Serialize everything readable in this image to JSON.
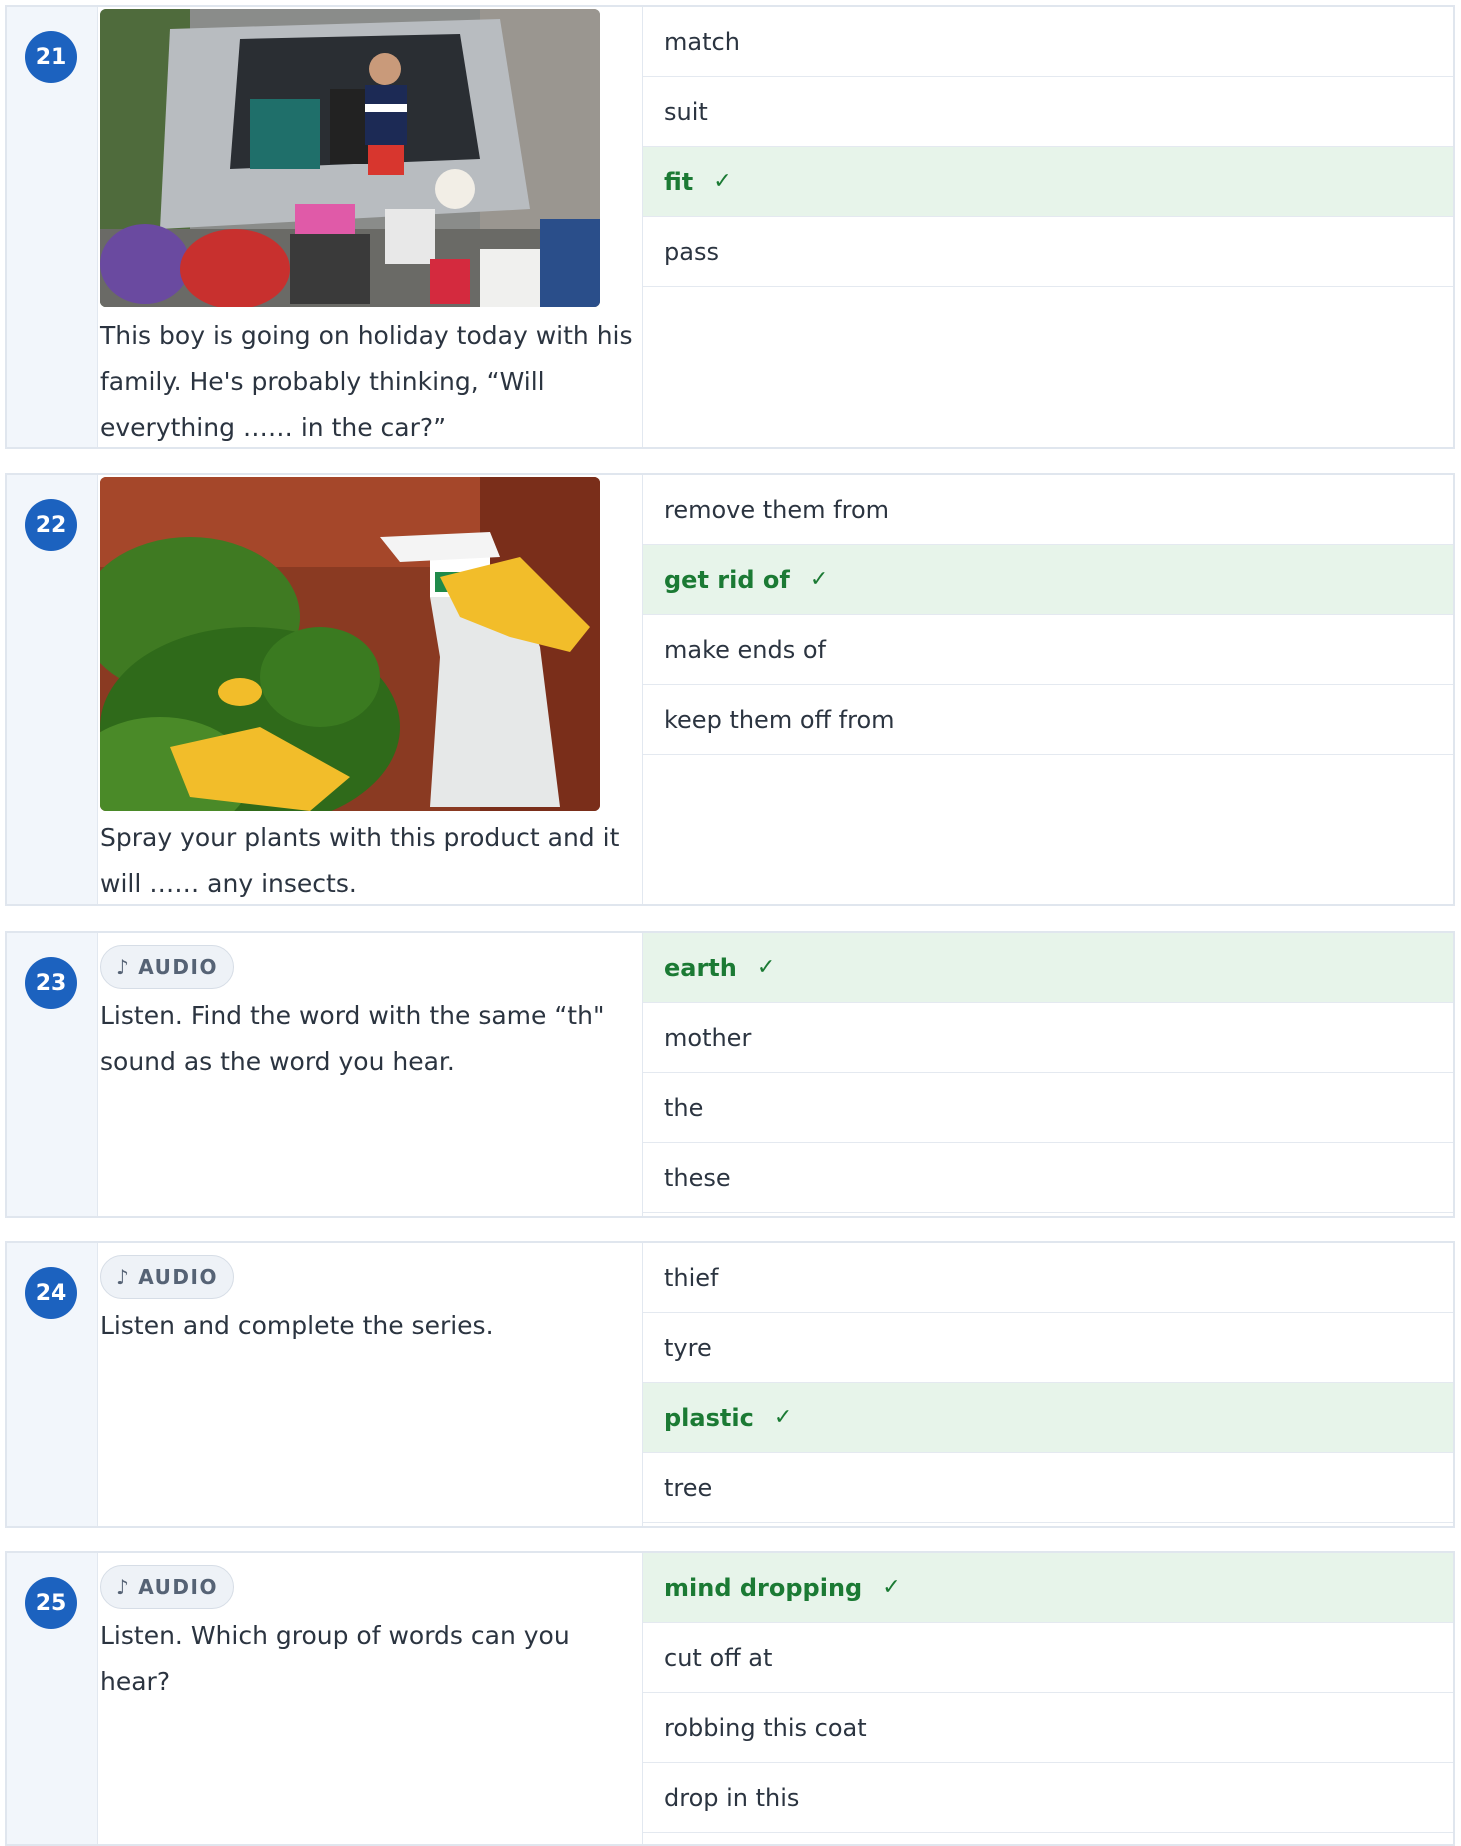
{
  "questions": [
    {
      "number": "21",
      "text_lines": [
        "This boy is going on holiday today with his",
        "family. He's probably thinking, “Will",
        "everything …… in the car?”"
      ],
      "options": [
        {
          "label": "match",
          "correct": false
        },
        {
          "label": "suit",
          "correct": false
        },
        {
          "label": "fit",
          "correct": true
        },
        {
          "label": "pass",
          "correct": false
        }
      ]
    },
    {
      "number": "22",
      "text_lines": [
        "Spray your plants with this product and it",
        "will …… any insects."
      ],
      "options": [
        {
          "label": "remove them from",
          "correct": false
        },
        {
          "label": "get rid of",
          "correct": true
        },
        {
          "label": "make ends of",
          "correct": false
        },
        {
          "label": "keep them off from",
          "correct": false
        }
      ]
    },
    {
      "number": "23",
      "audio_label": "AUDIO",
      "text_lines": [
        "Listen. Find the word with the same “th\"",
        "sound as the word you hear."
      ],
      "options": [
        {
          "label": "earth",
          "correct": true
        },
        {
          "label": "mother",
          "correct": false
        },
        {
          "label": "the",
          "correct": false
        },
        {
          "label": "these",
          "correct": false
        }
      ]
    },
    {
      "number": "24",
      "audio_label": "AUDIO",
      "text_lines": [
        "Listen and complete the series."
      ],
      "options": [
        {
          "label": "thief",
          "correct": false
        },
        {
          "label": "tyre",
          "correct": false
        },
        {
          "label": "plastic",
          "correct": true
        },
        {
          "label": "tree",
          "correct": false
        }
      ]
    },
    {
      "number": "25",
      "audio_label": "AUDIO",
      "text_lines": [
        "Listen. Which group of words can you",
        "hear?"
      ],
      "options": [
        {
          "label": "mind dropping",
          "correct": true
        },
        {
          "label": "cut off at",
          "correct": false
        },
        {
          "label": "robbing this coat",
          "correct": false
        },
        {
          "label": "drop in this",
          "correct": false
        }
      ]
    }
  ],
  "icons": {
    "audio": "music-note-icon",
    "correct": "check-icon"
  },
  "colors": {
    "badge": "#1c62bf",
    "correct_bg": "#e7f4ea",
    "correct_text": "#1b7a34"
  }
}
